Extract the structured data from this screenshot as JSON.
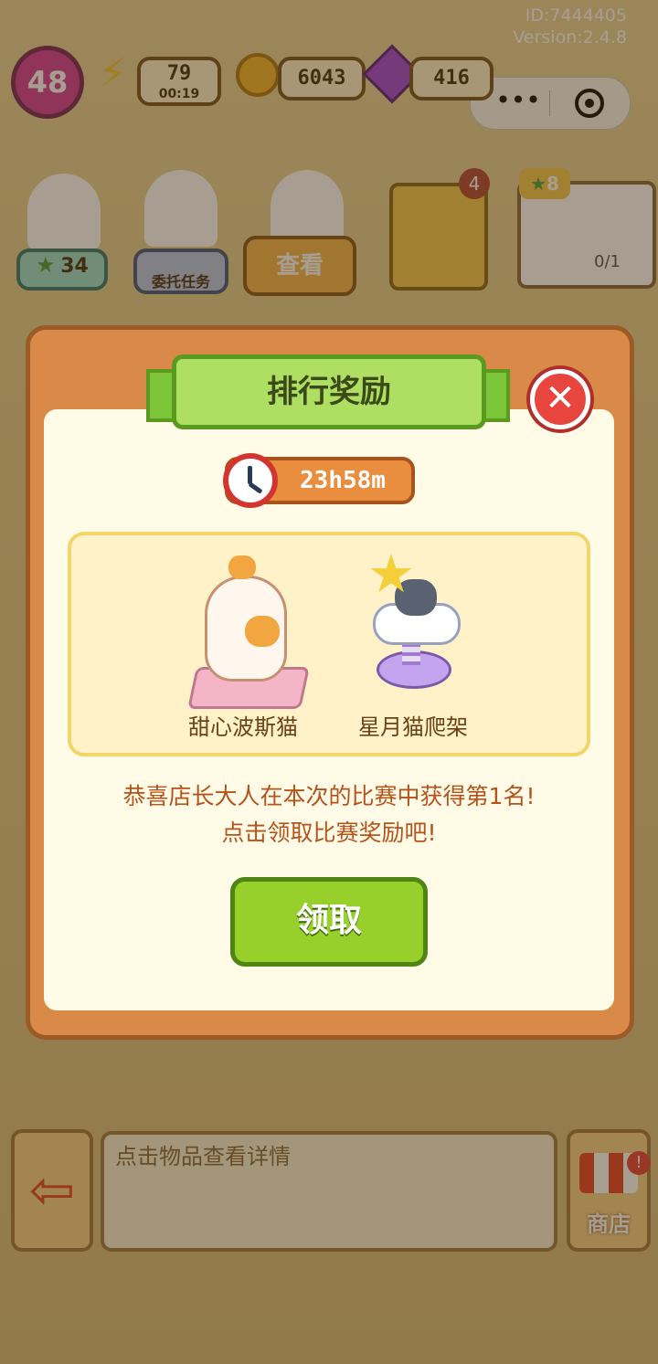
{
  "header": {
    "id_text": "ID:7444405",
    "version_text": "Version:2.4.8"
  },
  "player": {
    "level": "48"
  },
  "resources": {
    "energy": "79",
    "energy_timer": "00:19",
    "coins": "6043",
    "gems": "416"
  },
  "customers": {
    "stars": "34",
    "view_button": "查看",
    "order_button": "委托任务",
    "cards_count": "4",
    "stars_badge": "8",
    "progress": "0/1"
  },
  "modal": {
    "title": "排行奖励",
    "timer": "23h58m",
    "rewards": [
      {
        "name": "甜心波斯猫",
        "icon": "persian-cat-icon"
      },
      {
        "name": "星月猫爬架",
        "icon": "star-moon-cat-tree-icon"
      }
    ],
    "message_line1": "恭喜店长大人在本次的比赛中获得第1名!",
    "message_line2": "点击领取比赛奖励吧!",
    "claim_button": "领取"
  },
  "bottom": {
    "info_placeholder": "点击物品查看详情",
    "shop_label": "商店"
  },
  "colors": {
    "accent_green": "#97cf2b",
    "modal_orange": "#d98a48",
    "close_red": "#e8453e",
    "message_text": "#b5531c"
  }
}
